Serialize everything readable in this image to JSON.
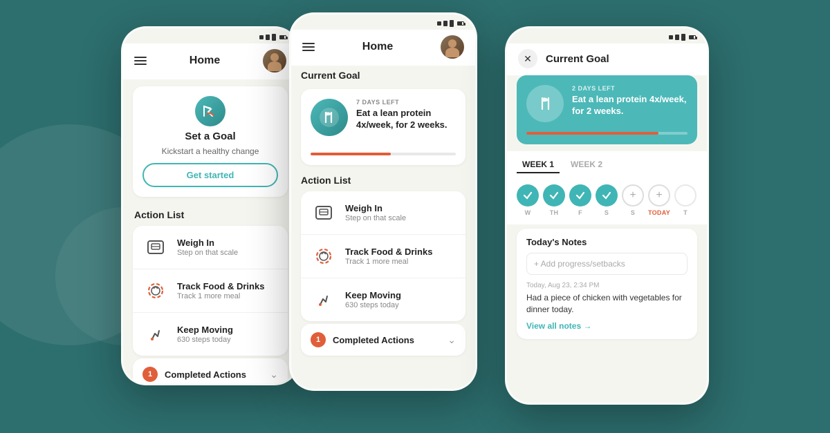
{
  "background": "#2d6e6e",
  "phone1": {
    "nav": {
      "title": "Home"
    },
    "goal_card": {
      "title": "Set a Goal",
      "subtitle": "Kickstart a healthy change",
      "btn_label": "Get started"
    },
    "action_list_label": "Action List",
    "actions": [
      {
        "name": "Weigh In",
        "sub": "Step on that scale",
        "icon": "scale"
      },
      {
        "name": "Track Food & Drinks",
        "sub": "Track 1 more meal",
        "icon": "food"
      },
      {
        "name": "Keep Moving",
        "sub": "630 steps today",
        "icon": "steps"
      }
    ],
    "completed": {
      "count": "1",
      "label": "Completed Actions"
    }
  },
  "phone2": {
    "nav": {
      "title": "Home"
    },
    "current_goal_label": "Current Goal",
    "goal": {
      "days_left": "7 DAYS LEFT",
      "text": "Eat a lean protein 4x/week, for 2 weeks.",
      "progress": 55
    },
    "action_list_label": "Action List",
    "actions": [
      {
        "name": "Weigh In",
        "sub": "Step on that scale",
        "icon": "scale"
      },
      {
        "name": "Track Food & Drinks",
        "sub": "Track 1 more meal",
        "icon": "food"
      },
      {
        "name": "Keep Moving",
        "sub": "630 steps today",
        "icon": "steps"
      }
    ],
    "completed": {
      "count": "1",
      "label": "Completed Actions"
    }
  },
  "phone3": {
    "nav": {
      "title": "Current Goal"
    },
    "goal": {
      "days_left": "2 DAYS LEFT",
      "text": "Eat a lean protein 4x/week, for 2 weeks.",
      "progress": 82
    },
    "week1_label": "WEEK 1",
    "week2_label": "WEEK 2",
    "days": [
      {
        "label": "W",
        "state": "completed"
      },
      {
        "label": "TH",
        "state": "completed"
      },
      {
        "label": "F",
        "state": "completed"
      },
      {
        "label": "S",
        "state": "completed"
      },
      {
        "label": "S",
        "state": "plus"
      },
      {
        "label": "TODAY",
        "state": "today"
      },
      {
        "label": "T",
        "state": "empty"
      }
    ],
    "notes_title": "Today's Notes",
    "notes_placeholder": "+ Add progress/setbacks",
    "note_date": "Today, Aug 23, 2:34 PM",
    "note_text": "Had a piece of chicken with vegetables for dinner today.",
    "view_all_label": "View all notes →"
  }
}
